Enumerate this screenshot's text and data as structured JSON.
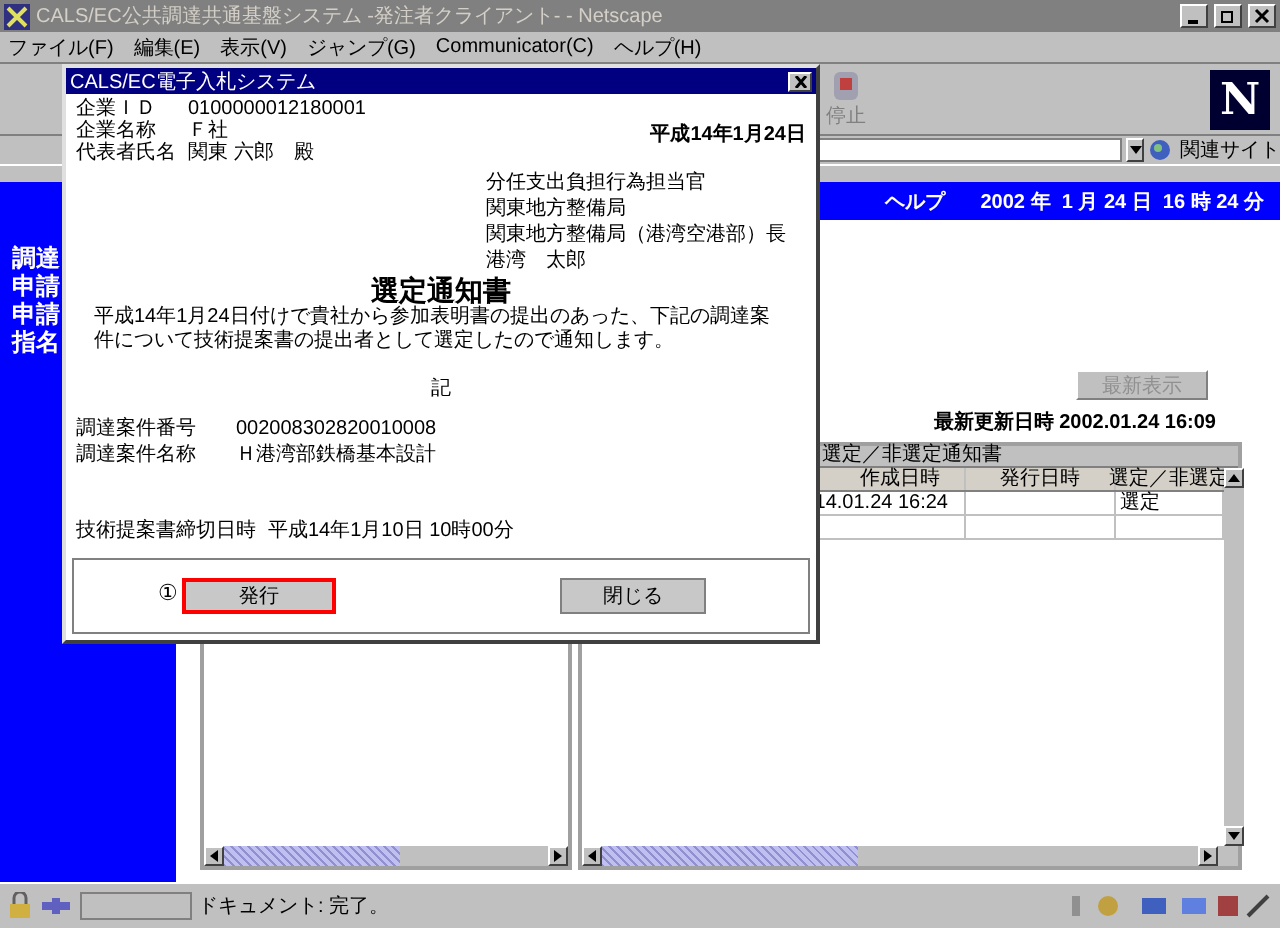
{
  "window": {
    "title": "CALS/EC公共調達共通基盤システム -発注者クライアント- - Netscape"
  },
  "menu": [
    "ファイル(F)",
    "編集(E)",
    "表示(V)",
    "ジャンプ(G)",
    "Communicator(C)",
    "ヘルプ(H)"
  ],
  "toolbar": {
    "stop_label": "停止",
    "logo": "N"
  },
  "location": {
    "related_label": "関連サイト"
  },
  "header": {
    "help": "ヘルプ",
    "datetime": "2002 年  1 月 24 日  16 時 24 分"
  },
  "sidebar": {
    "items": [
      "調達",
      "申請",
      "申請",
      "指名"
    ]
  },
  "refresh_button": {
    "label": "最新表示",
    "disabled": true
  },
  "last_updated": "最新更新日時 2002.01.24 16:09",
  "notices": {
    "title": "選定／非選定通知書",
    "columns": [
      "作成日時",
      "発行日時",
      "選定／非選定"
    ],
    "rows": [
      {
        "created": "14.01.24 16:24",
        "result": "選定"
      }
    ]
  },
  "status_bar": {
    "text": "ドキュメント: 完了。"
  },
  "dialog": {
    "title": "CALS/EC電子入札システム",
    "date": "平成14年1月24日",
    "company": [
      {
        "label": "企業ＩＤ",
        "value": "0100000012180001"
      },
      {
        "label": "企業名称",
        "value": "Ｆ社"
      },
      {
        "label": "代表者氏名",
        "value": "関東 六郎　殿"
      }
    ],
    "addressee": [
      "分任支出負担行為担当官",
      "関東地方整備局",
      "関東地方整備局（港湾空港部）長",
      "港湾　太郎"
    ],
    "heading": "選定通知書",
    "body": "平成14年1月24日付けで貴社から参加表明書の提出のあった、下記の調達案件について技術提案書の提出者として選定したので通知します。",
    "note_mark": "記",
    "items": [
      {
        "label": "調達案件番号",
        "value": "002008302820010008"
      },
      {
        "label": "調達案件名称",
        "value": "Ｈ港湾部鉄橋基本設計"
      }
    ],
    "deadline": {
      "label": "技術提案書締切日時",
      "value": "平成14年1月10日 10時00分"
    },
    "step_marker": "①",
    "buttons": [
      {
        "label": "発行",
        "highlighted": true
      },
      {
        "label": "閉じる",
        "highlighted": false
      }
    ]
  }
}
